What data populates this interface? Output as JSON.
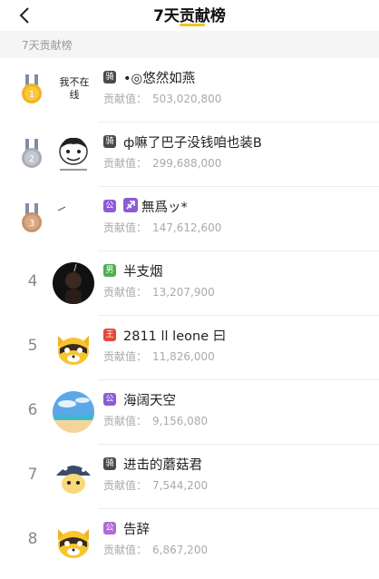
{
  "header": {
    "title": "7天贡献榜"
  },
  "section": {
    "label": "7天贡献榜"
  },
  "contrib_label": "贡献值：",
  "rows": [
    {
      "rank": "1",
      "avatar_text": "我不在线",
      "badge": "骑",
      "name": "•◎悠然如燕",
      "value": "503,020,800"
    },
    {
      "rank": "2",
      "badge": "骑",
      "name": "ф嘛了巴子没钱咱也装B",
      "value": "299,688,000"
    },
    {
      "rank": "3",
      "badge": "公",
      "name": "無爲ッ*",
      "value": "147,612,600"
    },
    {
      "rank": "4",
      "badge": "男",
      "name": "半支烟",
      "value": "13,207,900"
    },
    {
      "rank": "5",
      "badge": "王",
      "name": "2811 ll leone 曰",
      "value": "11,826,000"
    },
    {
      "rank": "6",
      "badge": "公",
      "name": "海阔天空",
      "value": "9,156,080"
    },
    {
      "rank": "7",
      "badge": "骑",
      "name": "进击的蘑菇君",
      "value": "7,544,200"
    },
    {
      "rank": "8",
      "badge": "公",
      "name": "告辞",
      "value": "6,867,200"
    }
  ],
  "colors": {
    "accent": "#f5c518",
    "gold": "#f2b31c",
    "silver": "#a9adb5",
    "bronze": "#c8926a",
    "badge_knight": "#4a4a4a",
    "badge_duke": "#8c5bd8",
    "badge_green": "#4caf50",
    "badge_red": "#e04a3a"
  }
}
